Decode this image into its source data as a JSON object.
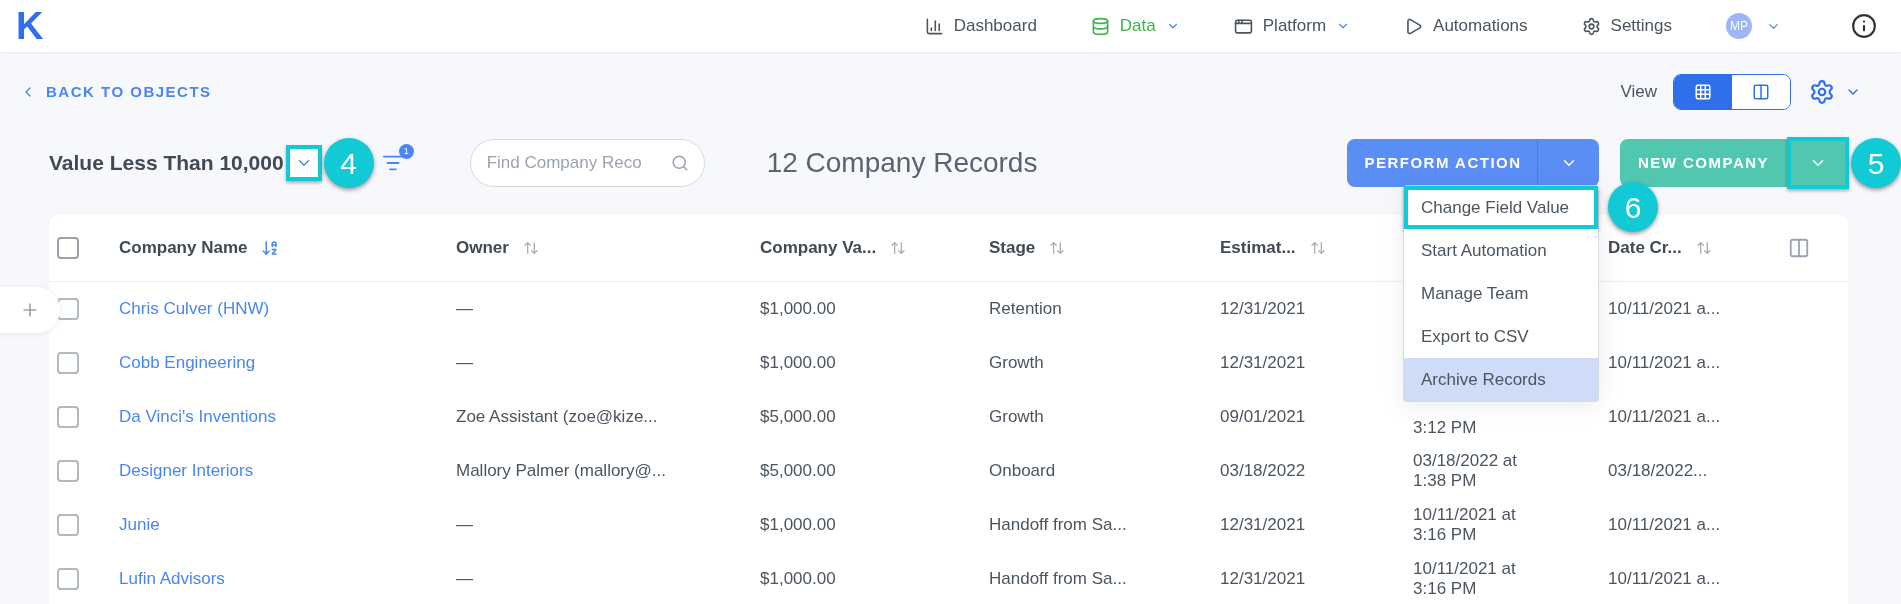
{
  "nav": {
    "logo": "K",
    "items": [
      {
        "label": "Dashboard",
        "selected": false,
        "has_menu": false
      },
      {
        "label": "Data",
        "selected": true,
        "has_menu": true
      },
      {
        "label": "Platform",
        "selected": false,
        "has_menu": true
      },
      {
        "label": "Automations",
        "selected": false,
        "has_menu": false
      },
      {
        "label": "Settings",
        "selected": false,
        "has_menu": false
      }
    ],
    "avatar": "MP"
  },
  "back_link": "BACK TO OBJECTS",
  "view": {
    "label": "View",
    "options": [
      {
        "selected": true
      },
      {
        "selected": false
      }
    ]
  },
  "toolbar": {
    "view_name": "Value Less Than 10,000",
    "view_menu_callout": "4",
    "filter_count": "1",
    "search": {
      "placeholder": "Find Company Reco"
    },
    "record_count": "12 Company Records",
    "perform_action": "PERFORM ACTION",
    "new_company": "NEW COMPANY",
    "new_company_callout": "5"
  },
  "actions_menu": [
    {
      "label": "Change Field Value",
      "highlighted": false,
      "callout": "6"
    },
    {
      "label": "Start Automation",
      "highlighted": false
    },
    {
      "label": "Manage Team",
      "highlighted": false
    },
    {
      "label": "Export to CSV",
      "highlighted": false
    },
    {
      "label": "Archive Records",
      "highlighted": true
    }
  ],
  "table": {
    "select_all": {
      "checked": false
    },
    "columns": [
      {
        "kind": "sortable",
        "label": "Company Name",
        "sorted": true
      },
      {
        "kind": "sortable",
        "label": "Owner",
        "sorted": false
      },
      {
        "kind": "sortable",
        "label": "Company Va...",
        "sorted": false
      },
      {
        "kind": "sortable",
        "label": "Stage",
        "sorted": false
      },
      {
        "kind": "sortable",
        "label": "Estimat...",
        "sorted": false
      },
      {
        "kind": "covered"
      },
      {
        "kind": "sortable",
        "label": "Date Cr...",
        "sorted": false
      }
    ],
    "rows": [
      {
        "checked": false,
        "cells": [
          "Chris Culver (HNW)",
          "—",
          "$1,000.00",
          "Retention",
          "12/31/2021",
          null,
          "10/11/2021 a..."
        ]
      },
      {
        "checked": false,
        "cells": [
          "Cobb Engineering",
          "—",
          "$1,000.00",
          "Growth",
          "12/31/2021",
          null,
          "10/11/2021 a..."
        ]
      },
      {
        "checked": false,
        "cells": [
          "Da Vinci's Inventions",
          "Zoe Assistant (zoe@kize...",
          "$5,000.00",
          "Growth",
          "09/01/2021",
          "3:12 PM",
          "10/11/2021 a..."
        ]
      },
      {
        "checked": false,
        "cells": [
          "Designer Interiors",
          "Mallory Palmer (mallory@...",
          "$5,000.00",
          "Onboard",
          "03/18/2022",
          "03/18/2022 at 1:38 PM",
          "03/18/2022..."
        ]
      },
      {
        "checked": false,
        "cells": [
          "Junie",
          "—",
          "$1,000.00",
          "Handoff from Sa...",
          "12/31/2021",
          "10/11/2021 at 3:16 PM",
          "10/11/2021 a..."
        ]
      },
      {
        "checked": false,
        "cells": [
          "Lufin Advisors",
          "—",
          "$1,000.00",
          "Handoff from Sa...",
          "12/31/2021",
          "10/11/2021 at 3:16 PM",
          "10/11/2021 a..."
        ]
      }
    ]
  }
}
